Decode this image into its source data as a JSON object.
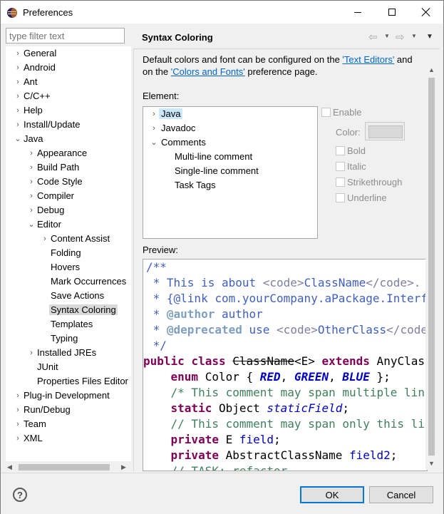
{
  "window": {
    "title": "Preferences"
  },
  "filter": {
    "placeholder": "type filter text"
  },
  "nav": [
    {
      "label": "General",
      "arrow": "›"
    },
    {
      "label": "Android",
      "arrow": "›"
    },
    {
      "label": "Ant",
      "arrow": "›"
    },
    {
      "label": "C/C++",
      "arrow": "›"
    },
    {
      "label": "Help",
      "arrow": "›"
    },
    {
      "label": "Install/Update",
      "arrow": "›"
    },
    {
      "label": "Java",
      "arrow": "⌄"
    },
    {
      "label": "Appearance",
      "arrow": "›"
    },
    {
      "label": "Build Path",
      "arrow": "›"
    },
    {
      "label": "Code Style",
      "arrow": "›"
    },
    {
      "label": "Compiler",
      "arrow": "›"
    },
    {
      "label": "Debug",
      "arrow": "›"
    },
    {
      "label": "Editor",
      "arrow": "⌄"
    },
    {
      "label": "Content Assist",
      "arrow": "›"
    },
    {
      "label": "Folding",
      "arrow": ""
    },
    {
      "label": "Hovers",
      "arrow": ""
    },
    {
      "label": "Mark Occurrences",
      "arrow": ""
    },
    {
      "label": "Save Actions",
      "arrow": ""
    },
    {
      "label": "Syntax Coloring",
      "arrow": ""
    },
    {
      "label": "Templates",
      "arrow": ""
    },
    {
      "label": "Typing",
      "arrow": ""
    },
    {
      "label": "Installed JREs",
      "arrow": "›"
    },
    {
      "label": "JUnit",
      "arrow": ""
    },
    {
      "label": "Properties Files Editor",
      "arrow": ""
    },
    {
      "label": "Plug-in Development",
      "arrow": "›"
    },
    {
      "label": "Run/Debug",
      "arrow": "›"
    },
    {
      "label": "Team",
      "arrow": "›"
    },
    {
      "label": "XML",
      "arrow": "›"
    }
  ],
  "page": {
    "title": "Syntax Coloring",
    "desc_part1": "Default colors and font can be configured on the ",
    "desc_link1": "'Text Editors'",
    "desc_part2": " and on the ",
    "desc_link2": "'Colors and Fonts'",
    "desc_part3": " preference page.",
    "element_label": "Element:",
    "preview_label": "Preview:"
  },
  "elements": [
    {
      "label": "Java",
      "arrow": "›"
    },
    {
      "label": "Javadoc",
      "arrow": "›"
    },
    {
      "label": "Comments",
      "arrow": "⌄"
    },
    {
      "label": "Multi-line comment",
      "arrow": ""
    },
    {
      "label": "Single-line comment",
      "arrow": ""
    },
    {
      "label": "Task Tags",
      "arrow": ""
    }
  ],
  "options": {
    "enable": "Enable",
    "color": "Color:",
    "bold": "Bold",
    "italic": "Italic",
    "strikethrough": "Strikethrough",
    "underline": "Underline"
  },
  "preview_code": {
    "l1": "/**",
    "l2a": " * This is about ",
    "l2b": "<code>",
    "l2c": "ClassName",
    "l2d": "</code>.",
    "l3a": " * {@link ",
    "l3b": "com.yourCompany.aPackage.Interface",
    "l4a": " * ",
    "l4b": "@author",
    "l4c": " author",
    "l5a": " * ",
    "l5b": "@deprecated",
    "l5c": " use ",
    "l5d": "<code>",
    "l5e": "OtherClass",
    "l5f": "</code>",
    "l6": " */",
    "l7a": "public",
    "l7b": " ",
    "l7c": "class",
    "l7d": " ",
    "l7e": "ClassName",
    "l7f": "<E> ",
    "l7g": "extends",
    "l7h": " AnyClass",
    "l8a": "    ",
    "l8b": "enum",
    "l8c": " Color { ",
    "l8d": "RED",
    "l8e": ", ",
    "l8f": "GREEN",
    "l8g": ", ",
    "l8h": "BLUE",
    "l8i": " };",
    "l9a": "    ",
    "l9b": "/* This comment may span multiple lines. */",
    "l10a": "    ",
    "l10b": "static",
    "l10c": " Object ",
    "l10d": "staticField",
    "l10e": ";",
    "l11a": "    ",
    "l11b": "// This comment may span only this line",
    "l12a": "    ",
    "l12b": "private",
    "l12c": " E ",
    "l12d": "field",
    "l12e": ";",
    "l13a": "    ",
    "l13b": "private",
    "l13c": " AbstractClassName ",
    "l13d": "field2",
    "l13e": ";",
    "l14a": "    ",
    "l14b": "// TASK: refactor"
  },
  "buttons": {
    "ok": "OK",
    "cancel": "Cancel",
    "help": "?"
  },
  "colors": {
    "accent": "#0078d7",
    "link": "#0066cc",
    "selected_nav": "#d9d9d9",
    "selected_element": "#cce8ff"
  }
}
